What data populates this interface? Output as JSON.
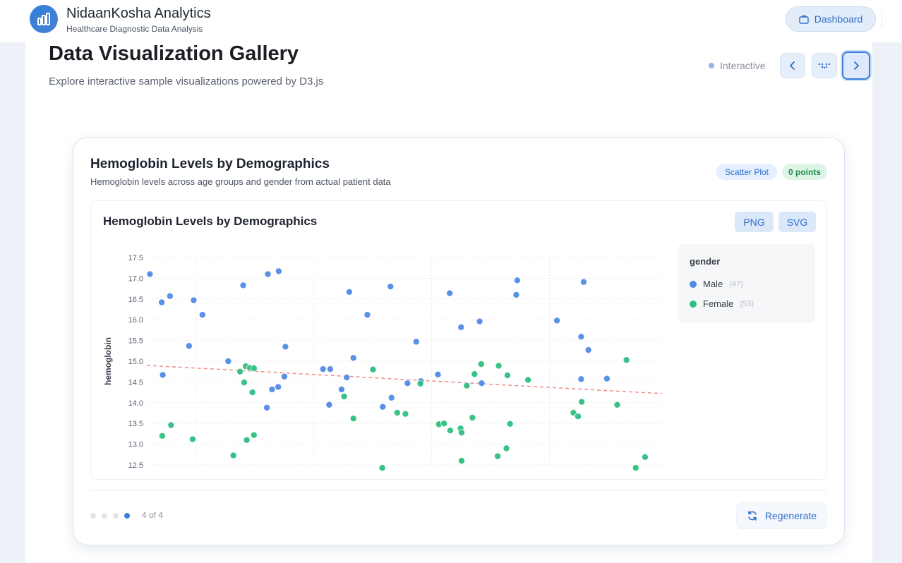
{
  "app": {
    "title": "NidaanKosha Analytics",
    "subtitle": "Healthcare Diagnostic Data Analysis",
    "dashboard_label": "Dashboard"
  },
  "page": {
    "title": "Data Visualization Gallery",
    "subtitle": "Explore interactive sample visualizations powered by D3.js",
    "mode_label": "Interactive"
  },
  "card": {
    "title": "Hemoglobin Levels by Demographics",
    "subtitle": "Hemoglobin levels across age groups and gender from actual patient data",
    "type_badge": "Scatter Plot",
    "points_badge": "0 points",
    "export_png": "PNG",
    "export_svg": "SVG",
    "pager_text": "4 of 4",
    "pager_total": 4,
    "pager_current": 4,
    "regenerate_label": "Regenerate"
  },
  "colors": {
    "male": "#4f8be6",
    "female": "#2fbf7f",
    "trend": "#f08a8a",
    "accent": "#2c6fc9"
  },
  "chart_data": {
    "type": "scatter",
    "title": "Hemoglobin Levels by Demographics",
    "ylabel": "hemoglobin",
    "xlabel": "",
    "ylim": [
      12.5,
      17.5
    ],
    "y_ticks": [
      "17.5",
      "17.0",
      "16.5",
      "16.0",
      "15.5",
      "15.0",
      "14.5",
      "14.0",
      "13.5",
      "13.0",
      "12.5"
    ],
    "xlim": [
      0,
      100
    ],
    "grid": true,
    "legend": {
      "title": "gender",
      "placement": "right",
      "entries": [
        {
          "name": "Male",
          "count": "(47)"
        },
        {
          "name": "Female",
          "count": "(53)"
        }
      ]
    },
    "trend_line": {
      "x": [
        0,
        100
      ],
      "y": [
        14.9,
        14.22
      ]
    },
    "series": [
      {
        "name": "Male",
        "points": [
          {
            "x": 0.6,
            "y": 17.1
          },
          {
            "x": 2.9,
            "y": 16.42
          },
          {
            "x": 3.1,
            "y": 14.67
          },
          {
            "x": 4.5,
            "y": 16.57
          },
          {
            "x": 8.2,
            "y": 15.37
          },
          {
            "x": 9.1,
            "y": 16.47
          },
          {
            "x": 10.8,
            "y": 16.12
          },
          {
            "x": 15.8,
            "y": 15.0
          },
          {
            "x": 18.7,
            "y": 16.83
          },
          {
            "x": 23.3,
            "y": 13.88
          },
          {
            "x": 23.5,
            "y": 17.1
          },
          {
            "x": 24.3,
            "y": 14.32
          },
          {
            "x": 25.5,
            "y": 14.38
          },
          {
            "x": 25.6,
            "y": 17.17
          },
          {
            "x": 26.7,
            "y": 14.63
          },
          {
            "x": 26.9,
            "y": 15.35
          },
          {
            "x": 34.2,
            "y": 14.81
          },
          {
            "x": 35.4,
            "y": 13.95
          },
          {
            "x": 35.6,
            "y": 14.81
          },
          {
            "x": 37.8,
            "y": 14.32
          },
          {
            "x": 38.8,
            "y": 14.61
          },
          {
            "x": 39.3,
            "y": 16.67
          },
          {
            "x": 40.1,
            "y": 15.08
          },
          {
            "x": 42.8,
            "y": 16.12
          },
          {
            "x": 45.8,
            "y": 13.9
          },
          {
            "x": 47.3,
            "y": 16.8
          },
          {
            "x": 47.5,
            "y": 14.12
          },
          {
            "x": 50.6,
            "y": 14.47
          },
          {
            "x": 52.3,
            "y": 15.47
          },
          {
            "x": 53.2,
            "y": 14.52
          },
          {
            "x": 56.5,
            "y": 14.68
          },
          {
            "x": 58.8,
            "y": 16.64
          },
          {
            "x": 61.0,
            "y": 15.82
          },
          {
            "x": 64.6,
            "y": 15.96
          },
          {
            "x": 65.0,
            "y": 14.47
          },
          {
            "x": 71.7,
            "y": 16.6
          },
          {
            "x": 71.9,
            "y": 16.95
          },
          {
            "x": 79.6,
            "y": 15.98
          },
          {
            "x": 84.3,
            "y": 15.59
          },
          {
            "x": 84.3,
            "y": 14.57
          },
          {
            "x": 84.8,
            "y": 16.91
          },
          {
            "x": 85.7,
            "y": 15.27
          },
          {
            "x": 89.3,
            "y": 14.58
          }
        ]
      },
      {
        "name": "Female",
        "points": [
          {
            "x": 3.0,
            "y": 13.2
          },
          {
            "x": 4.7,
            "y": 13.46
          },
          {
            "x": 8.9,
            "y": 13.12
          },
          {
            "x": 16.8,
            "y": 12.73
          },
          {
            "x": 18.1,
            "y": 14.75
          },
          {
            "x": 18.9,
            "y": 14.49
          },
          {
            "x": 19.2,
            "y": 14.88
          },
          {
            "x": 19.4,
            "y": 13.1
          },
          {
            "x": 20.0,
            "y": 14.84
          },
          {
            "x": 20.5,
            "y": 14.25
          },
          {
            "x": 20.8,
            "y": 13.22
          },
          {
            "x": 20.8,
            "y": 14.83
          },
          {
            "x": 38.3,
            "y": 14.15
          },
          {
            "x": 40.1,
            "y": 13.62
          },
          {
            "x": 43.9,
            "y": 14.8
          },
          {
            "x": 45.7,
            "y": 12.43
          },
          {
            "x": 48.6,
            "y": 13.76
          },
          {
            "x": 50.2,
            "y": 13.73
          },
          {
            "x": 53.1,
            "y": 14.46
          },
          {
            "x": 56.7,
            "y": 13.48
          },
          {
            "x": 57.7,
            "y": 13.5
          },
          {
            "x": 58.9,
            "y": 13.33
          },
          {
            "x": 60.9,
            "y": 13.38
          },
          {
            "x": 61.1,
            "y": 13.28
          },
          {
            "x": 61.1,
            "y": 12.6
          },
          {
            "x": 62.1,
            "y": 14.41
          },
          {
            "x": 63.2,
            "y": 13.64
          },
          {
            "x": 63.6,
            "y": 14.69
          },
          {
            "x": 64.9,
            "y": 14.93
          },
          {
            "x": 68.1,
            "y": 12.71
          },
          {
            "x": 68.3,
            "y": 14.89
          },
          {
            "x": 69.8,
            "y": 12.9
          },
          {
            "x": 70.0,
            "y": 14.66
          },
          {
            "x": 70.5,
            "y": 13.49
          },
          {
            "x": 74.0,
            "y": 14.55
          },
          {
            "x": 82.8,
            "y": 13.76
          },
          {
            "x": 83.7,
            "y": 13.67
          },
          {
            "x": 84.4,
            "y": 14.02
          },
          {
            "x": 91.3,
            "y": 13.95
          },
          {
            "x": 93.1,
            "y": 15.03
          },
          {
            "x": 94.9,
            "y": 12.43
          },
          {
            "x": 96.7,
            "y": 12.69
          }
        ]
      }
    ]
  }
}
